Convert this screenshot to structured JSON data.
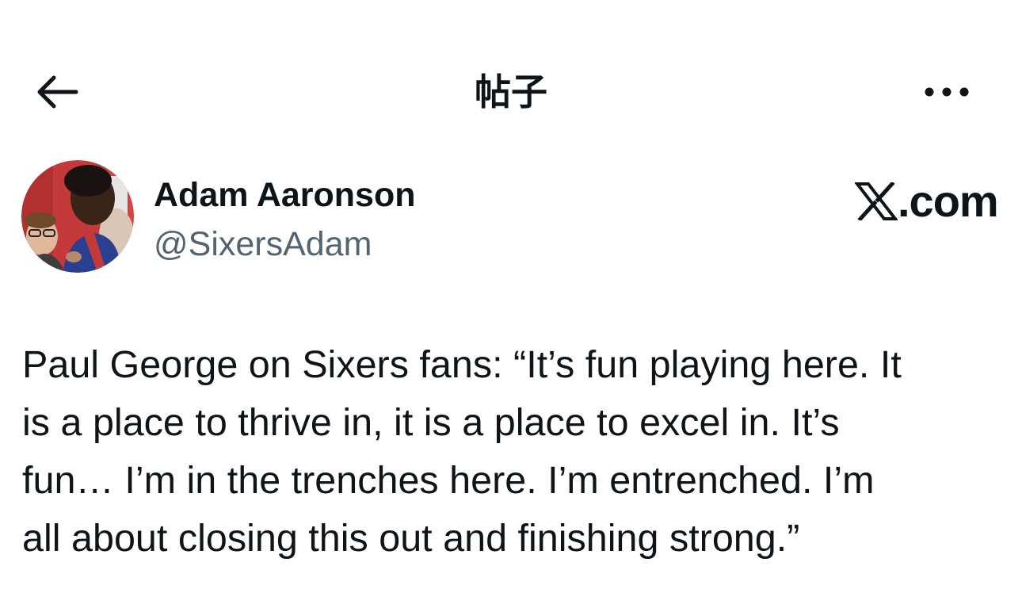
{
  "header": {
    "title": "帖子",
    "back_icon": "arrow-left-icon",
    "more_icon": "more-horizontal-icon"
  },
  "author": {
    "name": "Adam Aaronson",
    "handle": "@SixersAdam",
    "avatar": "profile-photo"
  },
  "brand": {
    "logo_icon": "x-logo-icon",
    "suffix": ".com"
  },
  "post": {
    "lines": [
      "Paul George on Sixers fans: “It’s fun playing here. It",
      "is a place to thrive in, it is a place to excel in. It’s",
      "fun… I’m in the trenches here. I’m entrenched. I’m",
      "all about closing this out and finishing strong.”"
    ]
  },
  "colors": {
    "text": "#0f1419",
    "secondary_text": "#536471",
    "background": "#ffffff"
  }
}
